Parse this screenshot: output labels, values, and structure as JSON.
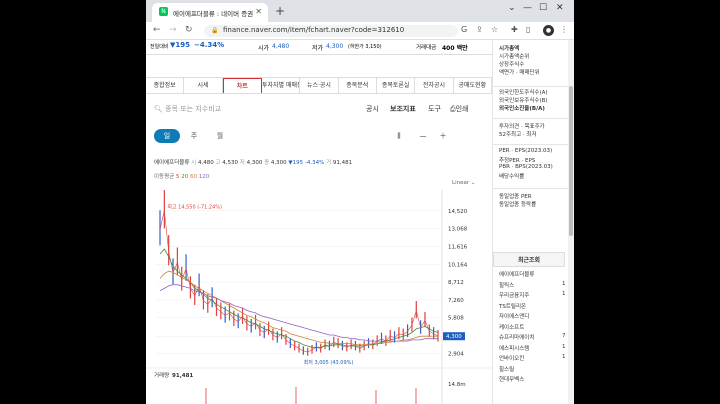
{
  "browser": {
    "tab_title": "에이에프더블류 : 네이버 증권",
    "url": "finance.naver.com/item/fchart.naver?code=312610"
  },
  "stickybar": {
    "prev_label": "전일대비",
    "change": "▼195",
    "change_pct": "−4.34%",
    "open_label": "시가",
    "open": "4,480",
    "low_label": "저가",
    "low": "4,300",
    "low_limit": "(하한가 3,150)",
    "amount_label": "거래대금",
    "amount": "400 백만"
  },
  "menu": [
    "종합정보",
    "시세",
    "차트",
    "투자자별 매매동향",
    "뉴스·공시",
    "종목분석",
    "종목토론실",
    "전자공시",
    "공매도현황"
  ],
  "toolbar": {
    "search_placeholder": "종목 또는 지수비교",
    "disclosure": "공시",
    "indicator": "보조지표",
    "tools": "도구",
    "print": "인쇄"
  },
  "periods": [
    "일",
    "주",
    "월"
  ],
  "ticker_line": {
    "name": "에이에프더블류",
    "open_k": "시",
    "open": "4,480",
    "high_k": "고",
    "high": "4,530",
    "low_k": "저",
    "low": "4,300",
    "close_k": "종",
    "close": "4,300",
    "chg": "▼195 -4.34%",
    "vol_k": "거",
    "vol": "91,481"
  },
  "ma_line": {
    "label": "이동평균",
    "values": [
      "5",
      "20",
      "60",
      "120"
    ]
  },
  "scale_label": "Linear",
  "chart_data": {
    "type": "line",
    "y_ticks": [
      "14,520",
      "13,068",
      "11,616",
      "10,164",
      "8,712",
      "7,260",
      "5,808",
      "4,300",
      "2,904"
    ],
    "ylim": [
      2200,
      15400
    ],
    "high_annotation": "최고 14,550 (-71.24%)",
    "low_annotation": "최저 3,005 (43.09%)",
    "current_label": "4,300",
    "volume_label": "거래량",
    "volume": "91,481",
    "volume_tick": "14.8m",
    "series": [
      {
        "color": "#e04040",
        "values": [
          13000,
          14550,
          11200,
          9500,
          10300,
          8900,
          9800,
          8200,
          7600,
          8400,
          7200,
          6900,
          7400,
          6600,
          6300,
          6000,
          6200,
          5700,
          5500,
          5900,
          5300,
          5100,
          5400,
          4800,
          4600,
          4900,
          4400,
          4200,
          4500,
          4000,
          3700,
          3500,
          3300,
          3100,
          3005,
          3200,
          3400,
          3300,
          3600,
          3500,
          3800,
          3700,
          3500,
          3400,
          3600,
          3500,
          3300,
          3500,
          3700,
          3600,
          3900,
          4100,
          3900,
          4300,
          4200,
          4500,
          4400,
          4700,
          5200,
          6400,
          5000,
          5600,
          4700,
          4500,
          4300
        ]
      },
      {
        "color": "#3a8e3a",
        "values": [
          11000,
          11400,
          10800,
          10000,
          9600,
          9300,
          9000,
          8700,
          8200,
          8000,
          7700,
          7400,
          7200,
          6900,
          6700,
          6500,
          6300,
          6100,
          5900,
          5800,
          5600,
          5400,
          5300,
          5100,
          4900,
          4800,
          4600,
          4500,
          4400,
          4300,
          4100,
          3900,
          3800,
          3600,
          3500,
          3400,
          3400,
          3400,
          3500,
          3500,
          3600,
          3600,
          3600,
          3500,
          3500,
          3500,
          3500,
          3500,
          3600,
          3600,
          3700,
          3800,
          3900,
          4000,
          4100,
          4200,
          4300,
          4400,
          4600,
          4900,
          5000,
          5100,
          4900,
          4700,
          4600
        ]
      },
      {
        "color": "#d08030",
        "values": [
          9000,
          9400,
          9600,
          9500,
          9300,
          9100,
          8900,
          8700,
          8400,
          8200,
          8000,
          7800,
          7600,
          7400,
          7200,
          7000,
          6800,
          6600,
          6400,
          6200,
          6000,
          5900,
          5700,
          5500,
          5400,
          5200,
          5000,
          4900,
          4800,
          4700,
          4500,
          4400,
          4300,
          4200,
          4100,
          4000,
          3900,
          3800,
          3800,
          3700,
          3700,
          3700,
          3700,
          3700,
          3700,
          3600,
          3600,
          3600,
          3600,
          3700,
          3700,
          3700,
          3800,
          3800,
          3900,
          3900,
          4000,
          4000,
          4100,
          4200,
          4300,
          4300,
          4300,
          4300,
          4300
        ]
      },
      {
        "color": "#9060c0",
        "values": [
          8000,
          8200,
          8400,
          8500,
          8500,
          8400,
          8300,
          8200,
          8000,
          7900,
          7800,
          7600,
          7500,
          7400,
          7200,
          7100,
          7000,
          6800,
          6700,
          6600,
          6400,
          6300,
          6200,
          6000,
          5900,
          5800,
          5700,
          5600,
          5500,
          5400,
          5300,
          5200,
          5100,
          5000,
          4900,
          4800,
          4700,
          4600,
          4500,
          4400,
          4400,
          4300,
          4200,
          4200,
          4100,
          4100,
          4000,
          4000,
          3900,
          3900,
          3900,
          3900,
          3900,
          3900,
          3900,
          3900,
          3900,
          3900,
          4000,
          4000,
          4000,
          4100,
          4100,
          4100,
          4100
        ]
      }
    ]
  },
  "side": {
    "items1": [
      "시가총액",
      "시가총액순위",
      "상장주식수",
      "액면가 · 매매단위"
    ],
    "items2": [
      "외국인한도주식수(A)",
      "외국인보유주식수(B)",
      "외국인소진율(B/A)"
    ],
    "items3": [
      "투자의견 · 목표주가",
      "52주최고 · 최저"
    ],
    "items4": [
      "PER · EPS(2023.03)",
      "추정PER · EPS",
      "PBR · BPS(2023.03)",
      "배당수익률"
    ],
    "items5": [
      "동일업종 PER",
      "동일업종 등락률"
    ],
    "recent_title": "최근조회",
    "recent": [
      {
        "name": "에이에프더블류",
        "num": ""
      },
      {
        "name": "힐릭스",
        "num": "1"
      },
      {
        "name": "우리금융지주",
        "num": "1"
      },
      {
        "name": "TS트릴리온",
        "num": ""
      },
      {
        "name": "자이에스앤디",
        "num": ""
      },
      {
        "name": "케이소프트",
        "num": ""
      },
      {
        "name": "슈프리마에이치",
        "num": "7"
      },
      {
        "name": "에스피시스템",
        "num": "1"
      },
      {
        "name": "언바이오킨",
        "num": "1"
      },
      {
        "name": "힐스릴",
        "num": ""
      },
      {
        "name": "현대무벡스",
        "num": ""
      }
    ]
  }
}
